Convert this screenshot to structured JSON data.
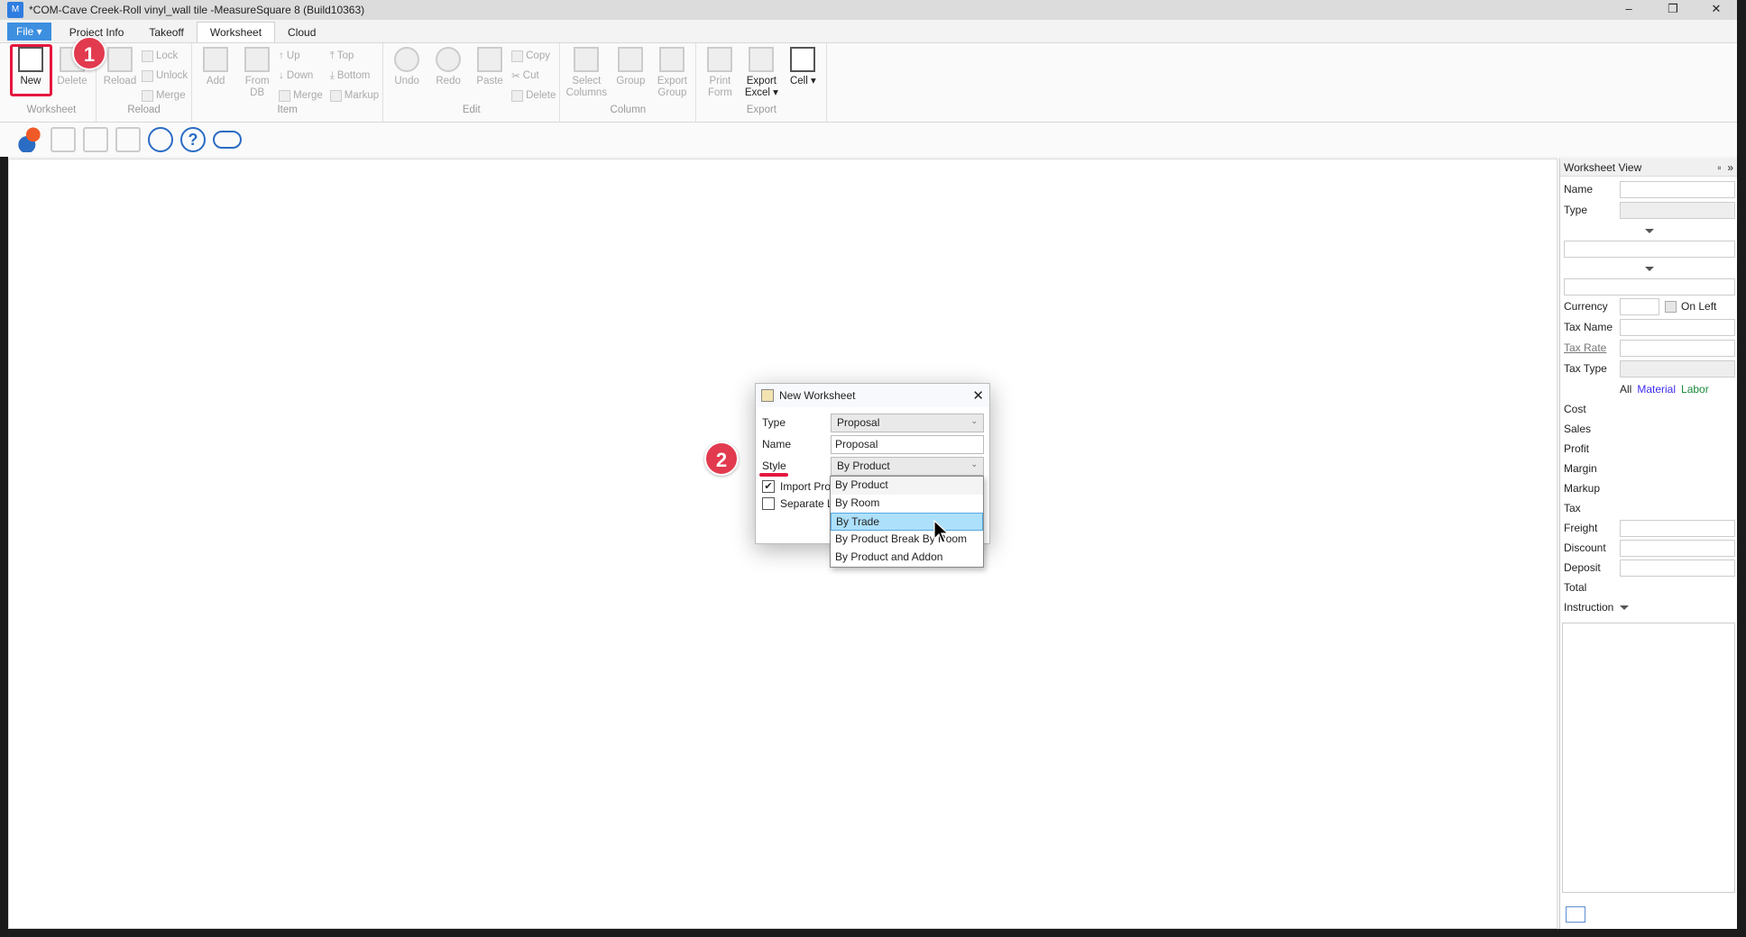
{
  "window": {
    "title": "*COM-Cave Creek-Roll vinyl_wall tile -MeasureSquare 8 (Build10363)",
    "app_icon": "M"
  },
  "tabs": [
    "File ▾",
    "Project Info",
    "Takeoff",
    "Worksheet",
    "Cloud"
  ],
  "ribbon": {
    "worksheet": {
      "label": "Worksheet",
      "new": "New",
      "delete": "Delete"
    },
    "reload": {
      "label": "Reload",
      "reload": "Reload",
      "lock": "Lock",
      "unlock": "Unlock",
      "merge": "Merge"
    },
    "item": {
      "label": "Item",
      "add": "Add",
      "from_db": "From DB",
      "up": "Up",
      "down": "Down",
      "merge": "Merge",
      "top": "Top",
      "bottom": "Bottom",
      "markup": "Markup"
    },
    "edit": {
      "label": "Edit",
      "undo": "Undo",
      "redo": "Redo",
      "paste": "Paste",
      "copy": "Copy",
      "cut": "Cut",
      "delete": "Delete"
    },
    "column": {
      "label": "Column",
      "select_columns": "Select Columns",
      "group": "Group",
      "export_group": "Export Group"
    },
    "export": {
      "label": "Export",
      "print_form": "Print Form",
      "export_excel": "Export Excel ▾",
      "cell": "Cell ▾"
    }
  },
  "annotations": {
    "step1": "1",
    "step2": "2"
  },
  "dialog": {
    "title": "New Worksheet",
    "type_label": "Type",
    "type_value": "Proposal",
    "name_label": "Name",
    "name_value": "Proposal",
    "style_label": "Style",
    "style_value": "By Product",
    "import_label": "Import Pro",
    "import_checked": true,
    "separate_label": "Separate L",
    "separate_checked": false,
    "style_options": [
      "By Product",
      "By Room",
      "By Trade",
      "By Product Break By Room",
      "By Product and Addon"
    ],
    "highlighted_option": "By Trade"
  },
  "panel": {
    "title": "Worksheet View",
    "name": "Name",
    "type": "Type",
    "currency": "Currency",
    "on_left": "On Left",
    "tax_name": "Tax Name",
    "tax_rate": "Tax Rate",
    "tax_type": "Tax Type",
    "all": "All",
    "material": "Material",
    "labor": "Labor",
    "cost": "Cost",
    "sales": "Sales",
    "profit": "Profit",
    "margin": "Margin",
    "markup": "Markup",
    "tax": "Tax",
    "freight": "Freight",
    "discount": "Discount",
    "deposit": "Deposit",
    "total": "Total",
    "instruction": "Instruction",
    "colors": {
      "material": "#3b2cf0",
      "labor": "#1a8a3a"
    }
  }
}
